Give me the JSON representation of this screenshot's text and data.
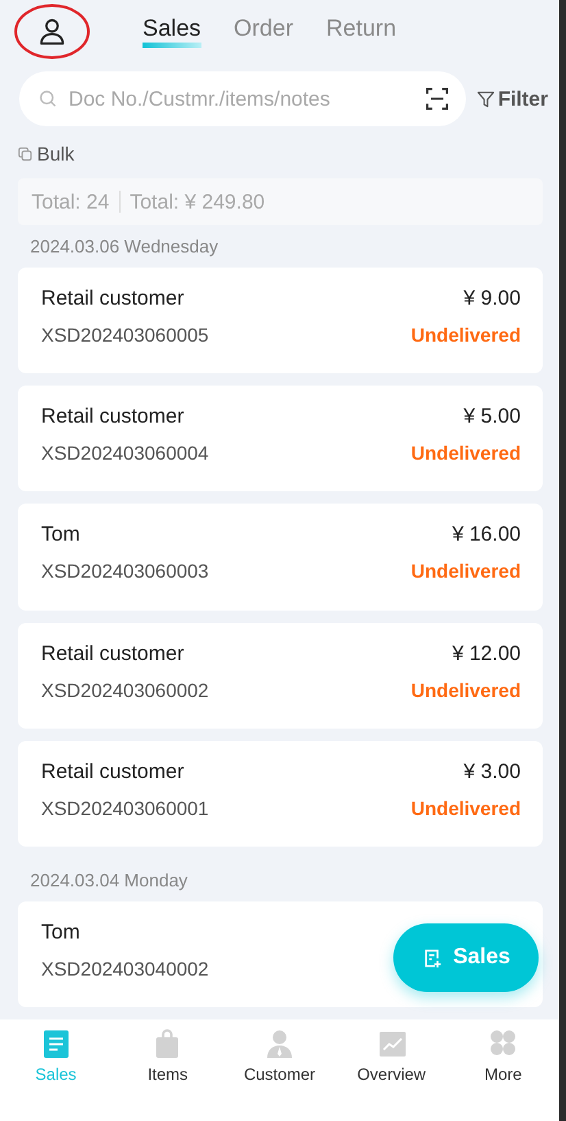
{
  "tabs": [
    {
      "label": "Sales",
      "selected": true
    },
    {
      "label": "Order",
      "selected": false
    },
    {
      "label": "Return",
      "selected": false
    }
  ],
  "search": {
    "placeholder": "Doc No./Custmr./items/notes"
  },
  "filter_label": "Filter",
  "bulk_label": "Bulk",
  "summary": {
    "count": "Total: 24",
    "amount": "Total: ¥ 249.80"
  },
  "groups": [
    {
      "date": "2024.03.06 Wednesday",
      "orders": [
        {
          "customer": "Retail customer",
          "number": "XSD202403060005",
          "amount": "¥ 9.00",
          "status": "Undelivered"
        },
        {
          "customer": "Retail customer",
          "number": "XSD202403060004",
          "amount": "¥ 5.00",
          "status": "Undelivered"
        },
        {
          "customer": "Tom",
          "number": "XSD202403060003",
          "amount": "¥ 16.00",
          "status": "Undelivered"
        },
        {
          "customer": "Retail customer",
          "number": "XSD202403060002",
          "amount": "¥ 12.00",
          "status": "Undelivered"
        },
        {
          "customer": "Retail customer",
          "number": "XSD202403060001",
          "amount": "¥ 3.00",
          "status": "Undelivered"
        }
      ]
    },
    {
      "date": "2024.03.04 Monday",
      "orders": [
        {
          "customer": "Tom",
          "number": "XSD202403040002"
        }
      ]
    }
  ],
  "fab_label": "Sales",
  "nav": [
    {
      "label": "Sales",
      "kind": "doc",
      "selected": true
    },
    {
      "label": "Items",
      "kind": "bag",
      "selected": false
    },
    {
      "label": "Customer",
      "kind": "person",
      "selected": false
    },
    {
      "label": "Overview",
      "kind": "chart",
      "selected": false
    },
    {
      "label": "More",
      "kind": "grid",
      "selected": false
    }
  ]
}
